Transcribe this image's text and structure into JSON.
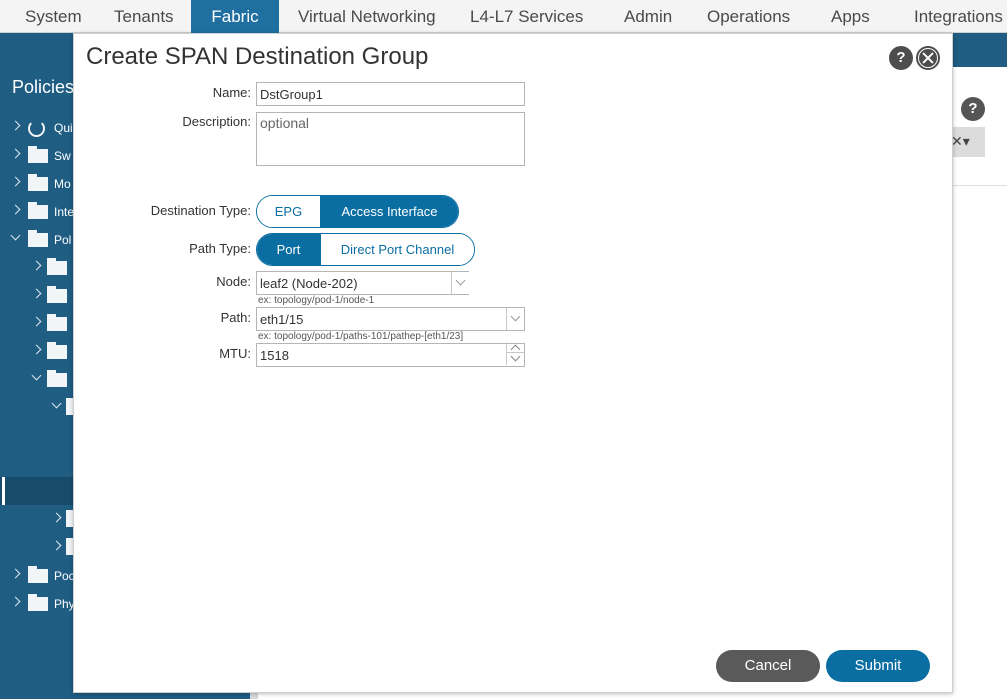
{
  "topnav": {
    "tabs": [
      "System",
      "Tenants",
      "Fabric",
      "Virtual Networking",
      "L4-L7 Services",
      "Admin",
      "Operations",
      "Apps",
      "Integrations"
    ],
    "active": "Fabric"
  },
  "sidebar": {
    "title": "Policies",
    "items": [
      {
        "label": "Qui",
        "icon": "quick-start-icon"
      },
      {
        "label": "Sw",
        "icon": "folder-icon"
      },
      {
        "label": "Mo",
        "icon": "folder-icon"
      },
      {
        "label": "Inte",
        "icon": "folder-icon"
      },
      {
        "label": "Pol",
        "icon": "folder-icon"
      },
      {
        "label": "Poc",
        "icon": "folder-icon"
      },
      {
        "label": "Phy",
        "icon": "folder-icon"
      }
    ]
  },
  "dialog": {
    "title": "Create SPAN Destination Group",
    "help_icon": "?",
    "fields": {
      "name": {
        "label": "Name:",
        "value": "DstGroup1"
      },
      "description": {
        "label": "Description:",
        "placeholder": "optional"
      },
      "destination_type": {
        "label": "Destination Type:",
        "options": [
          "EPG",
          "Access Interface"
        ],
        "selected": "Access Interface"
      },
      "path_type": {
        "label": "Path Type:",
        "options": [
          "Port",
          "Direct Port Channel"
        ],
        "selected": "Port"
      },
      "node": {
        "label": "Node:",
        "value": "leaf2 (Node-202)",
        "hint": "ex: topology/pod-1/node-1"
      },
      "path": {
        "label": "Path:",
        "value": "eth1/15",
        "hint": "ex: topology/pod-1/paths-101/pathep-[eth1/23]"
      },
      "mtu": {
        "label": "MTU:",
        "value": "1518"
      }
    },
    "buttons": {
      "cancel": "Cancel",
      "submit": "Submit"
    }
  },
  "background": {
    "help_icon": "?"
  },
  "colors": {
    "nav_active": "#1f6fa0",
    "sidebar": "#1f5d83",
    "accent": "#0a6ea3",
    "cancel": "#5a5a5a",
    "submit": "#0a6ea3"
  }
}
